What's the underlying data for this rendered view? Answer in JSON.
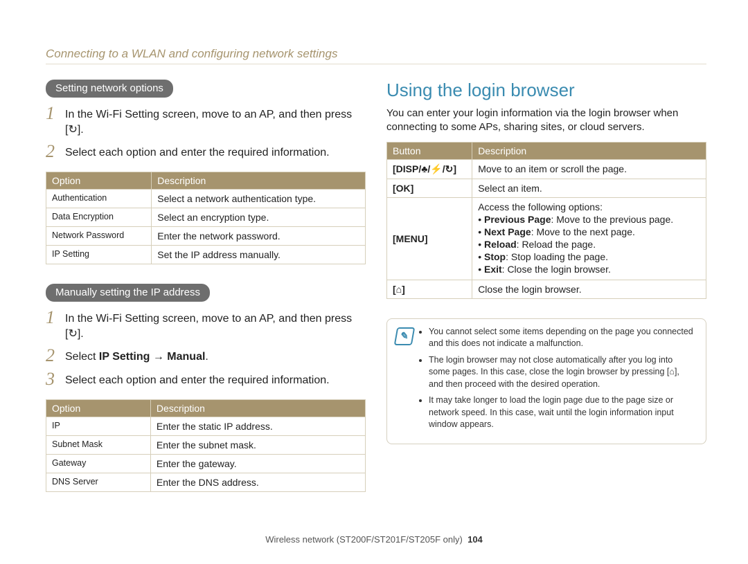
{
  "header": "Connecting to a WLAN and configuring network settings",
  "left": {
    "pill1": "Setting network options",
    "steps1": [
      "In the Wi-Fi Setting screen, move to an AP, and then press [↻].",
      "Select each option and enter the required information."
    ],
    "table1": {
      "headers": [
        "Option",
        "Description"
      ],
      "rows": [
        [
          "Authentication",
          "Select a network authentication type."
        ],
        [
          "Data Encryption",
          "Select an encryption type."
        ],
        [
          "Network Password",
          "Enter the network password."
        ],
        [
          "IP Setting",
          "Set the IP address manually."
        ]
      ]
    },
    "pill2": "Manually setting the IP address",
    "steps2_1": "In the Wi-Fi Setting screen, move to an AP, and then press [↻].",
    "steps2_2_pre": "Select ",
    "steps2_2_bold": "IP Setting → Manual",
    "steps2_2_post": ".",
    "steps2_3": "Select each option and enter the required information.",
    "table2": {
      "headers": [
        "Option",
        "Description"
      ],
      "rows": [
        [
          "IP",
          "Enter the static IP address."
        ],
        [
          "Subnet Mask",
          "Enter the subnet mask."
        ],
        [
          "Gateway",
          "Enter the gateway."
        ],
        [
          "DNS Server",
          "Enter the DNS address."
        ]
      ]
    }
  },
  "right": {
    "title": "Using the login browser",
    "intro": "You can enter your login information via the login browser when connecting to some APs, sharing sites, or cloud servers.",
    "table": {
      "headers": [
        "Button",
        "Description"
      ],
      "row1_btn": "[DISP/♣/⚡/↻]",
      "row1_desc": "Move to an item or scroll the page.",
      "row2_btn": "[OK]",
      "row2_desc": "Select an item.",
      "row3_btn": "[MENU]",
      "row3_desc_head": "Access the following options:",
      "row3_items": [
        {
          "b": "Previous Page",
          "t": ": Move to the previous page."
        },
        {
          "b": "Next Page",
          "t": ": Move to the next page."
        },
        {
          "b": "Reload",
          "t": ": Reload the page."
        },
        {
          "b": "Stop",
          "t": ": Stop loading the page."
        },
        {
          "b": "Exit",
          "t": ": Close the login browser."
        }
      ],
      "row4_btn": "[⌂]",
      "row4_desc": "Close the login browser."
    },
    "notes": [
      "You cannot select some items depending on the page you connected and this does not indicate a malfunction.",
      "The login browser may not close automatically after you log into some pages. In this case, close the login browser by pressing [⌂], and then proceed with the desired operation.",
      "It may take longer to load the login page due to the page size or network speed. In this case, wait until the login information input window appears."
    ]
  },
  "footer": {
    "text": "Wireless network (ST200F/ST201F/ST205F only)",
    "page": "104"
  }
}
